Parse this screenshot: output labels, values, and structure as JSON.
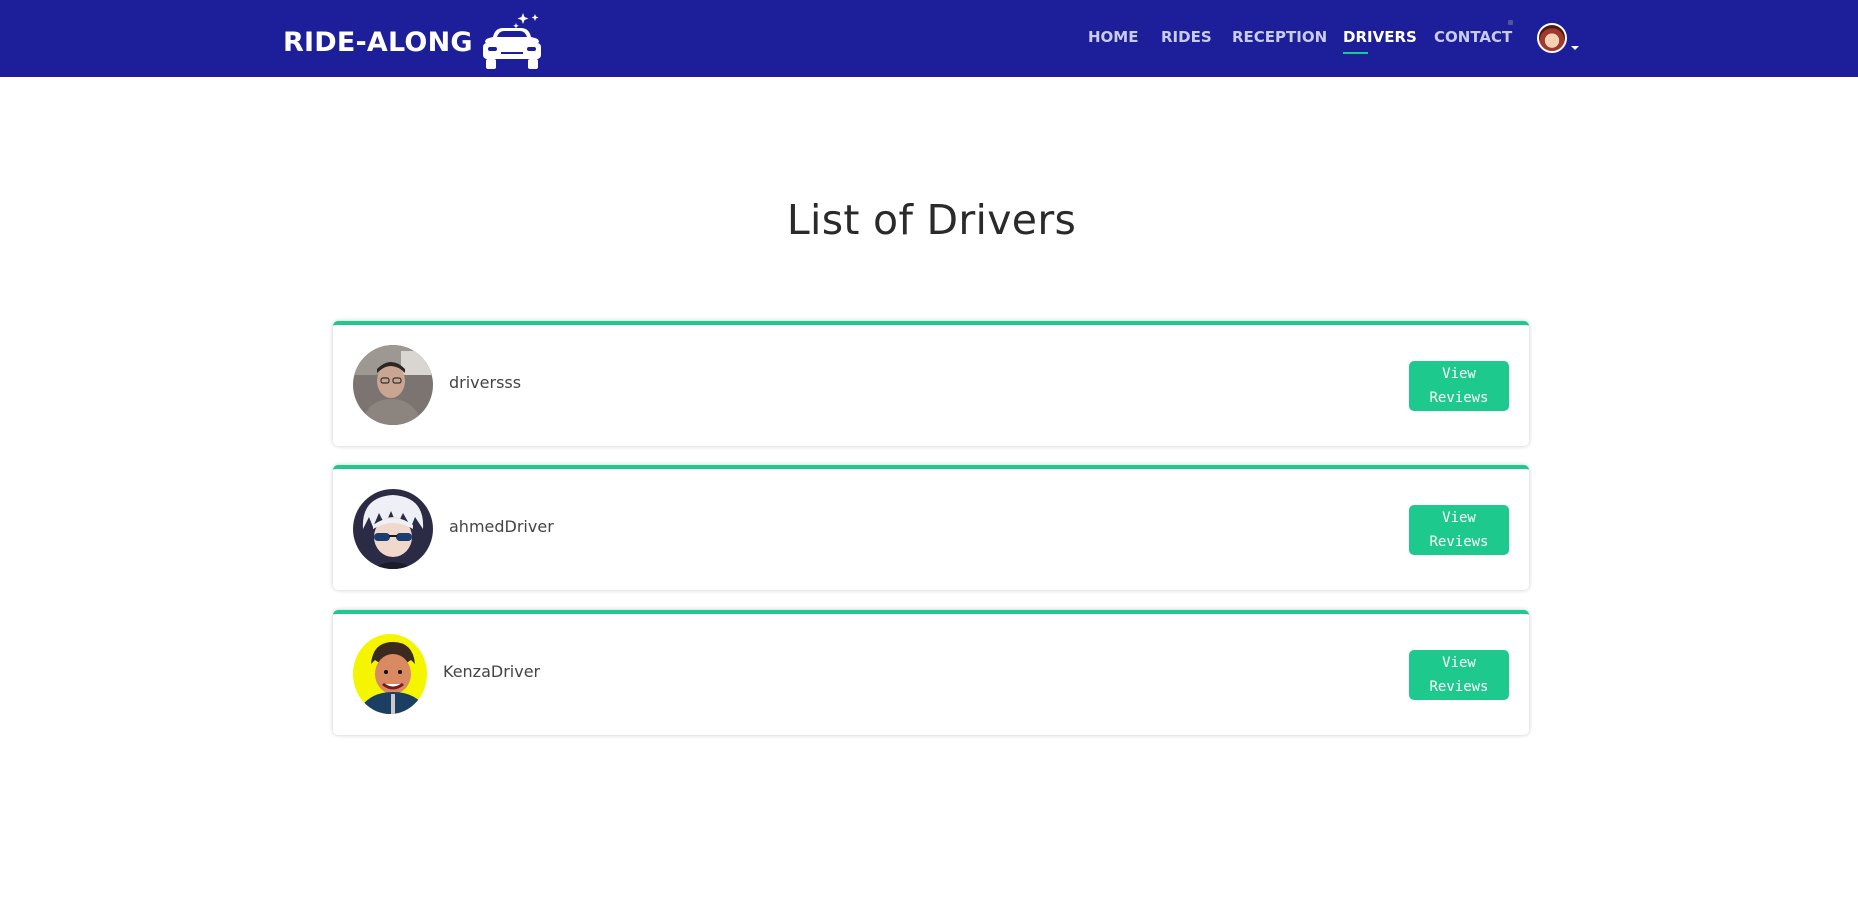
{
  "header": {
    "brand": "RIDE-ALONG",
    "brand_icon": "car-with-sparkles-icon",
    "nav": [
      {
        "label": "HOME"
      },
      {
        "label": "RIDES"
      },
      {
        "label": "RECEPTION"
      },
      {
        "label": "DRIVERS",
        "active": true
      },
      {
        "label": "CONTACT"
      }
    ],
    "user_menu_icon": "user-avatar-icon"
  },
  "main": {
    "title": "List of Drivers",
    "drivers": [
      {
        "name": "driversss",
        "button_label": "View Reviews"
      },
      {
        "name": "ahmedDriver",
        "button_label": "View Reviews"
      },
      {
        "name": "KenzaDriver",
        "button_label": "View Reviews"
      }
    ]
  },
  "colors": {
    "navbar": "#1c1f99",
    "accent": "#1ec98e",
    "text": "#2a2a2a"
  }
}
